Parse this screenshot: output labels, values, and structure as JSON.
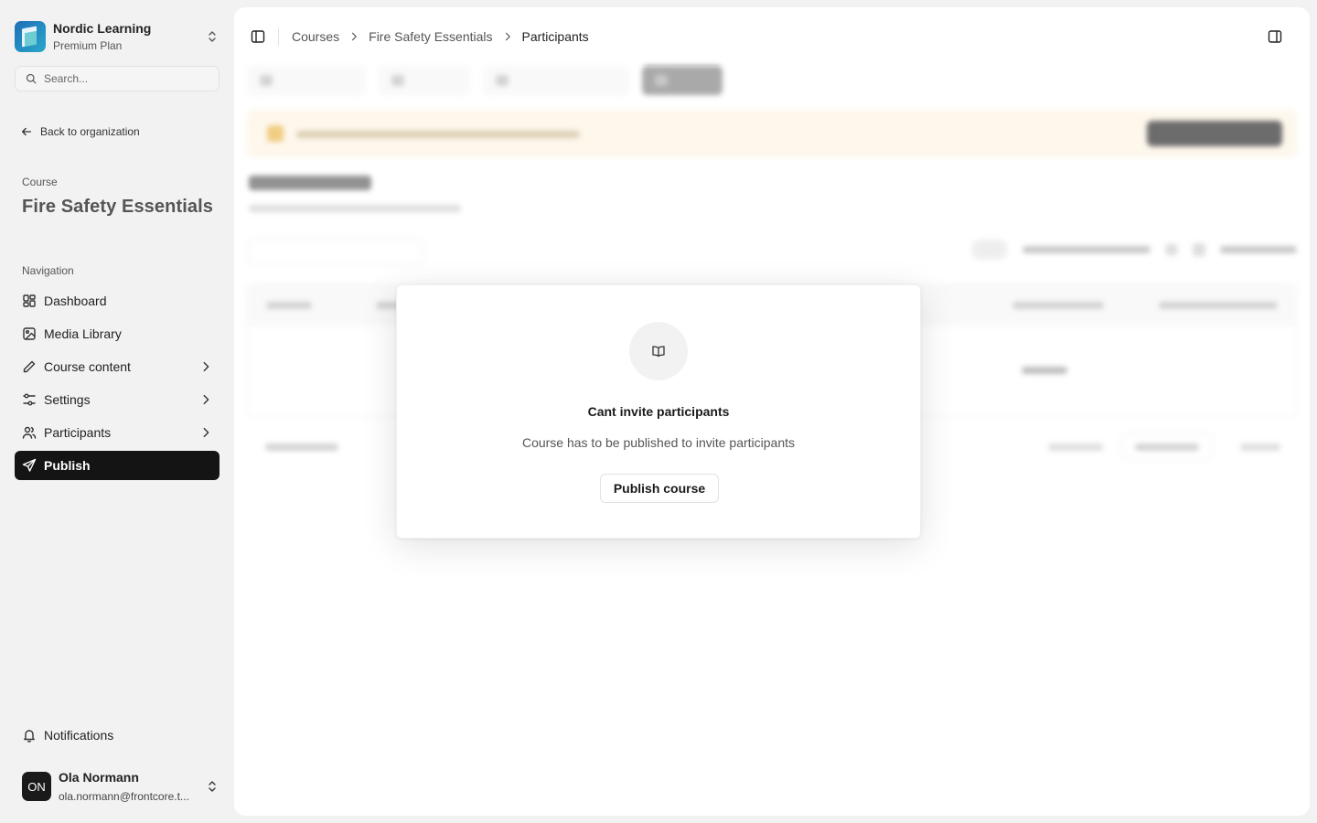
{
  "org": {
    "name": "Nordic Learning",
    "plan": "Premium Plan"
  },
  "sidebar": {
    "search_placeholder": "Search...",
    "back_label": "Back to organization",
    "course_label": "Course",
    "course_title": "Fire Safety Essentials",
    "nav_label": "Navigation",
    "items": [
      {
        "label": "Dashboard",
        "icon": "dashboard-icon"
      },
      {
        "label": "Media Library",
        "icon": "image-icon"
      },
      {
        "label": "Course content",
        "icon": "pencil-icon"
      },
      {
        "label": "Settings",
        "icon": "sliders-icon"
      },
      {
        "label": "Participants",
        "icon": "users-icon"
      },
      {
        "label": "Publish",
        "icon": "send-icon",
        "active": true
      }
    ],
    "notifications_label": "Notifications"
  },
  "user": {
    "initials": "ON",
    "name": "Ola Normann",
    "email": "ola.normann@frontcore.t..."
  },
  "breadcrumb": [
    "Courses",
    "Fire Safety Essentials",
    "Participants"
  ],
  "dialog": {
    "icon": "book-open-icon",
    "title": "Cant invite participants",
    "description": "Course has to be published to invite participants",
    "button_label": "Publish course"
  },
  "colors": {
    "active_nav_bg": "#141414",
    "banner_bg": "#fdf3e2",
    "page_bg": "#f2f2f2"
  }
}
